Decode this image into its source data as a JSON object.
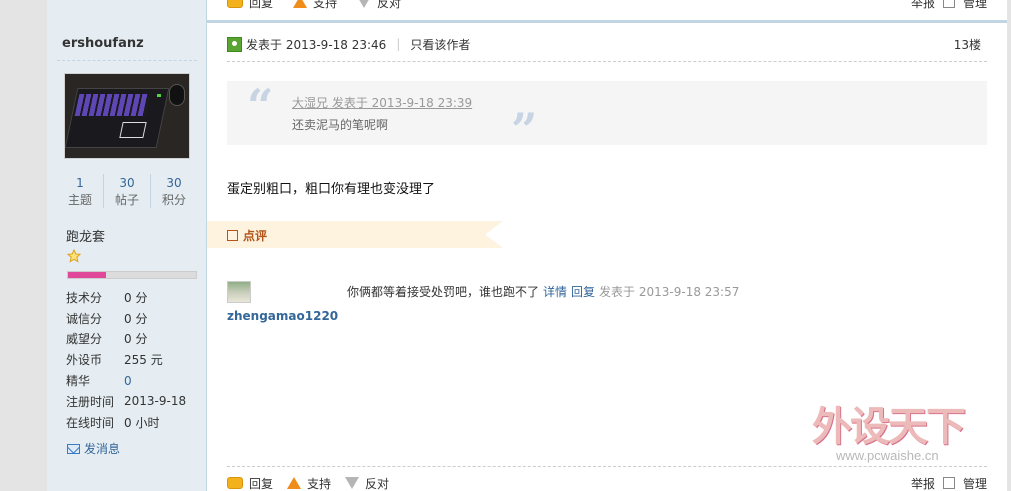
{
  "top_actions": {
    "reply": "回复",
    "support": "支持",
    "oppose": "反对",
    "report": "举报",
    "manage": "管理"
  },
  "sidebar": {
    "username": "ershoufanz",
    "stats": [
      {
        "num": "1",
        "label": "主题"
      },
      {
        "num": "30",
        "label": "帖子"
      },
      {
        "num": "30",
        "label": "积分"
      }
    ],
    "rank": "跑龙套",
    "rank_progress": 0.3,
    "info": [
      {
        "k": "技术分",
        "v": "0 分"
      },
      {
        "k": "诚信分",
        "v": "0 分"
      },
      {
        "k": "威望分",
        "v": "0 分"
      },
      {
        "k": "外设币",
        "v": "255 元"
      },
      {
        "k": "精华",
        "v": "0"
      },
      {
        "k": "注册时间",
        "v": "2013-9-18"
      },
      {
        "k": "在线时间",
        "v": "0 小时"
      }
    ],
    "send_message": "发消息"
  },
  "post": {
    "posted_at": "发表于 2013-9-18 23:46",
    "only_author": "只看该作者",
    "floor": "13楼",
    "quote": {
      "author": "大湿兄",
      "time": "发表于 2013-9-18 23:39",
      "text": "还卖泥马的笔呢啊"
    },
    "body": "蛋定别粗口，粗口你有理也变没理了",
    "comment_label": "点评"
  },
  "comment": {
    "user": "zhengamao1220",
    "text": "你俩都等着接受处罚吧，谁也跑不了",
    "detail": "详情",
    "reply": "回复",
    "time": "发表于 2013-9-18 23:57"
  },
  "bottom_actions": {
    "reply": "回复",
    "support": "支持",
    "oppose": "反对",
    "report": "举报",
    "manage": "管理"
  },
  "watermark": {
    "title": "外设天下",
    "url": "www.pcwaishe.cn"
  }
}
